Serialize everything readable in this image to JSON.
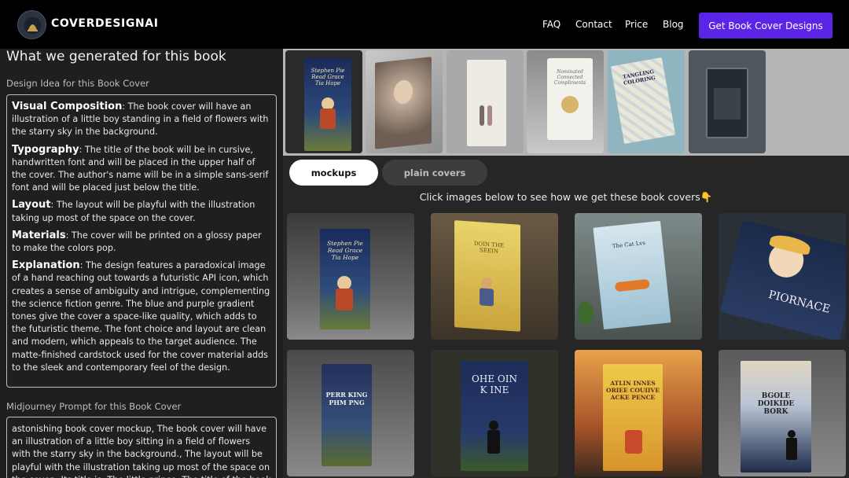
{
  "header": {
    "brand": "COVERDESIGNAI",
    "nav": [
      "FAQ",
      "Contact",
      "Price",
      "Blog"
    ],
    "cta": "Get Book Cover Designs"
  },
  "left": {
    "heading": "What we generated for this book",
    "idea_label": "Design Idea for this Book Cover",
    "idea": [
      {
        "key": "Visual Composition",
        "text": ": The book cover will have an illustration of a little boy standing in a field of flowers with the starry sky in the background."
      },
      {
        "key": "Typography",
        "text": ": The title of the book will be in cursive, handwritten font and will be placed in the upper half of the cover. The author's name will be in a simple sans-serif font and will be placed just below the title."
      },
      {
        "key": "Layout",
        "text": ": The layout will be playful with the illustration taking up most of the space on the cover."
      },
      {
        "key": "Materials",
        "text": ": The cover will be printed on a glossy paper to make the colors pop."
      },
      {
        "key": "Explanation",
        "text": ": The design features a paradoxical image of a hand reaching out towards a futuristic API icon, which creates a sense of ambiguity and intrigue, complementing the science fiction genre. The blue and purple gradient tones give the cover a space-like quality, which adds to the futuristic theme. The font choice and layout are clean and modern, which appeals to the target audience. The matte-finished cardstock used for the cover material adds to the sleek and contemporary feel of the design."
      }
    ],
    "prompt_label": "Midjourney Prompt for this Book Cover",
    "prompt": "astonishing book cover mockup, The book cover will have an illustration of a little boy sitting in a field of flowers with the starry sky in the background., The layout will be playful with the illustration taking up most of the space on the cover., Its title is: The little prince. The title of the book will be in cursive"
  },
  "right": {
    "tabs": [
      "mockups",
      "plain covers"
    ],
    "hint": "Click images below to see how we get these book covers👇",
    "strip_covers": [
      {
        "title": "Stephen Pie Read Grace Tia Hope"
      },
      {
        "title": ""
      },
      {
        "title": ""
      },
      {
        "title": "Nominated Connected Compliments"
      },
      {
        "title": "TANGLING COLORING"
      },
      {
        "title": ""
      }
    ],
    "grid_covers": [
      {
        "title": "Stephen Pie Read Grace Tia Hope"
      },
      {
        "title": "DOIN THE SEEIN"
      },
      {
        "title": "The Cat Lvs"
      },
      {
        "title": "PIORNACE"
      },
      {
        "title": "PERR KING PHM PNG"
      },
      {
        "title": "OHE OIN K INE"
      },
      {
        "title": "ATLIN INNES ORIEE COUIIVE ACKE PENCE"
      },
      {
        "title": "BGOLE DOIKIDE BORK"
      }
    ]
  },
  "colors": {
    "accent": "#5b24e6",
    "header_bg": "#000000",
    "panel_bg": "#1f1f1f"
  }
}
